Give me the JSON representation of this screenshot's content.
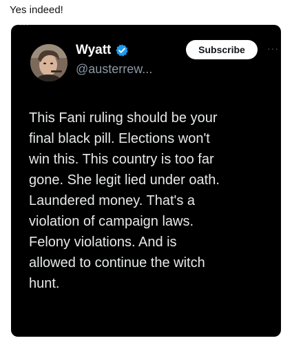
{
  "caption": "Yes indeed!",
  "tweet": {
    "cut_top_text": "···",
    "display_name": "Wyatt",
    "handle": "@austerrew...",
    "subscribe_label": "Subscribe",
    "more_icon": "more-horizontal-icon",
    "verified_icon": "verified-badge-icon",
    "verified_color": "#1d9bf0",
    "body": "This Fani ruling should be your\nfinal black pill. Elections won't\nwin this. This country is too far\ngone. She legit lied under oath.\nLaundered money. That's a\nviolation of campaign laws.\nFelony violations. And is\nallowed to continue the witch\nhunt."
  }
}
